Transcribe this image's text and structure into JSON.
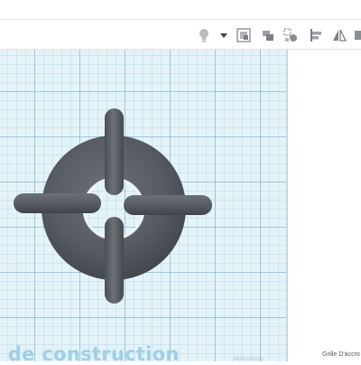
{
  "toolbar": {
    "tools": [
      {
        "name": "light-bulb-icon"
      },
      {
        "name": "dropdown-arrow-icon"
      },
      {
        "name": "view-box-icon"
      },
      {
        "name": "shapes-group-icon"
      },
      {
        "name": "hole-shapes-icon"
      },
      {
        "name": "align-icon"
      },
      {
        "name": "mirror-icon"
      },
      {
        "name": "group-icon"
      }
    ]
  },
  "workplane": {
    "label": "u de construction",
    "unit_label": "Millimètres"
  },
  "panel": {
    "snap_grid_label": "Grille D'accro"
  },
  "colors": {
    "shape": "#555b61",
    "grid_bg": "#e4f3f8",
    "label": "#9fd0e4"
  }
}
